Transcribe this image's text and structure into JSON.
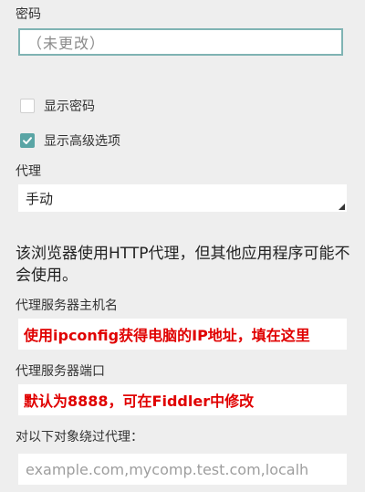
{
  "password": {
    "label": "密码",
    "value": "（未更改）"
  },
  "show_password": {
    "label": "显示密码",
    "checked": false
  },
  "show_advanced": {
    "label": "显示高级选项",
    "checked": true
  },
  "proxy": {
    "label": "代理",
    "selected": "手动"
  },
  "proxy_info": "该浏览器使用HTTP代理，但其他应用程序可能不会使用。",
  "proxy_hostname": {
    "label": "代理服务器主机名",
    "value": "使用ipconfig获得电脑的IP地址，填在这里"
  },
  "proxy_port": {
    "label": "代理服务器端口",
    "value": "默认为8888，可在Fiddler中修改"
  },
  "bypass": {
    "label": "对以下对象绕过代理：",
    "placeholder": "example.com,mycomp.test.com,localh"
  },
  "colors": {
    "accent": "#5aa5a5",
    "focus_border": "#7fb3b3",
    "annotation_red": "#e00000"
  }
}
